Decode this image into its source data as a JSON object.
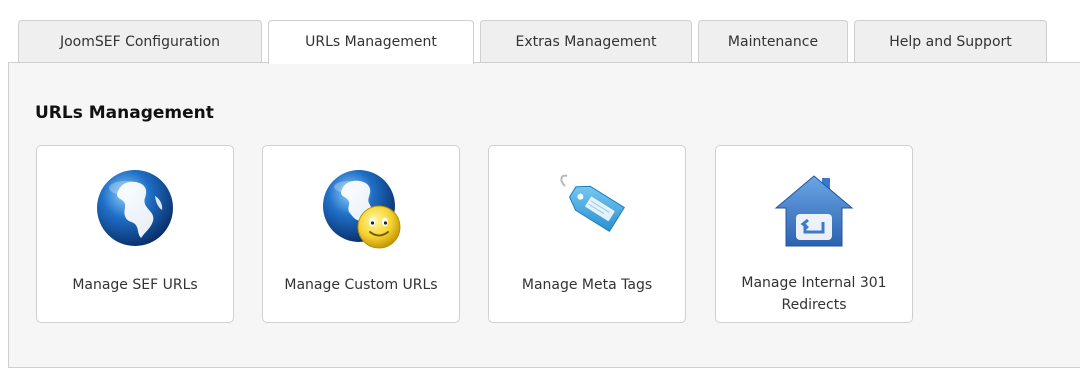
{
  "tabs": [
    {
      "label": "JoomSEF Configuration"
    },
    {
      "label": "URLs Management"
    },
    {
      "label": "Extras Management"
    },
    {
      "label": "Maintenance"
    },
    {
      "label": "Help and Support"
    }
  ],
  "panel": {
    "title": "URLs Management",
    "cards": [
      {
        "label": "Manage SEF URLs",
        "icon": "globe-icon"
      },
      {
        "label": "Manage Custom URLs",
        "icon": "globe-smiley-icon"
      },
      {
        "label": "Manage Meta Tags",
        "icon": "tag-icon"
      },
      {
        "label_line1": "Manage Internal 301",
        "label_line2": "Redirects",
        "icon": "house-redirect-icon"
      }
    ]
  },
  "colors": {
    "tab_bg": "#efefef",
    "panel_bg": "#f6f6f6",
    "card_border": "#d0d0d0",
    "globe_blue": "#1f6fc7",
    "tag_blue": "#43a9df",
    "house_blue": "#3d7ac6"
  }
}
